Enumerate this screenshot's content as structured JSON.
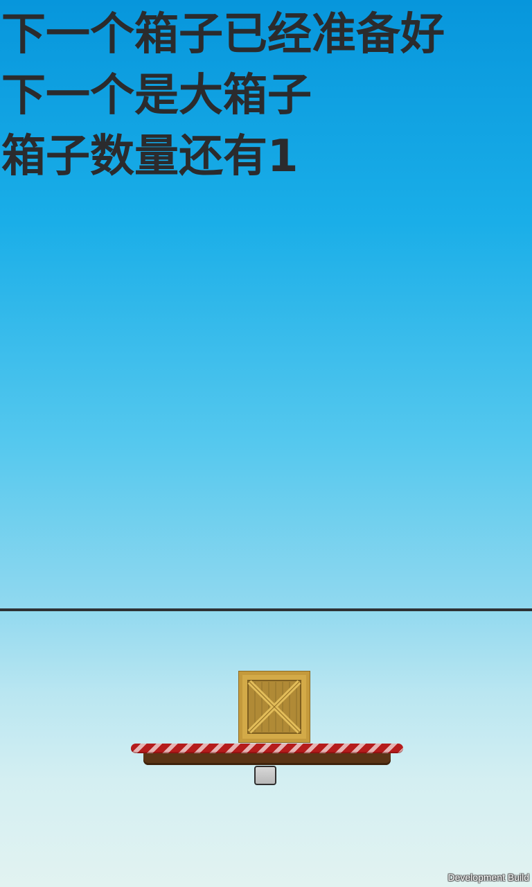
{
  "hud": {
    "line1": "下一个箱子已经准备好",
    "line2": "下一个是大箱子",
    "line3": "箱子数量还有1"
  },
  "footer": {
    "build_label": "Development Build"
  },
  "colors": {
    "sky_top": "#0796dc",
    "sky_bottom": "#e2f3f1",
    "hud_text": "#2b2b2d",
    "ground_line": "#2e3134",
    "crate_wood": "#c49a3c",
    "platform_stripe": "#b51c1c",
    "platform_base": "#5a3416",
    "pivot": "#c8c8c8"
  },
  "icons": {
    "crate": "wooden-crate-icon",
    "platform": "striped-balance-platform",
    "pivot": "grey-pivot-block"
  }
}
